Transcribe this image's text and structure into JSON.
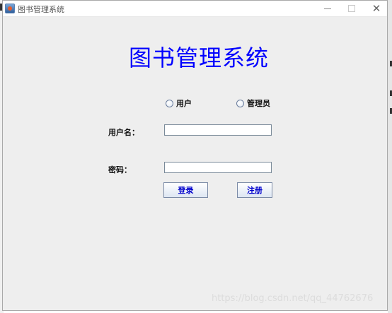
{
  "window": {
    "title": "图书管理系统"
  },
  "main": {
    "heading": "图书管理系统",
    "role_options": [
      "用户",
      "管理员"
    ],
    "username_label": "用户名：",
    "username_value": "",
    "password_label": "密码：",
    "password_value": "",
    "login_label": "登录",
    "register_label": "注册"
  },
  "watermark": "https://blog.csdn.net/qq_44762676",
  "colors": {
    "heading": "#0000ff",
    "button_text": "#0000cc",
    "window_bg": "#eeeeee"
  },
  "icons": {
    "app": "java-app-icon",
    "minimize": "minimize-icon",
    "maximize": "maximize-icon",
    "close": "close-icon"
  }
}
